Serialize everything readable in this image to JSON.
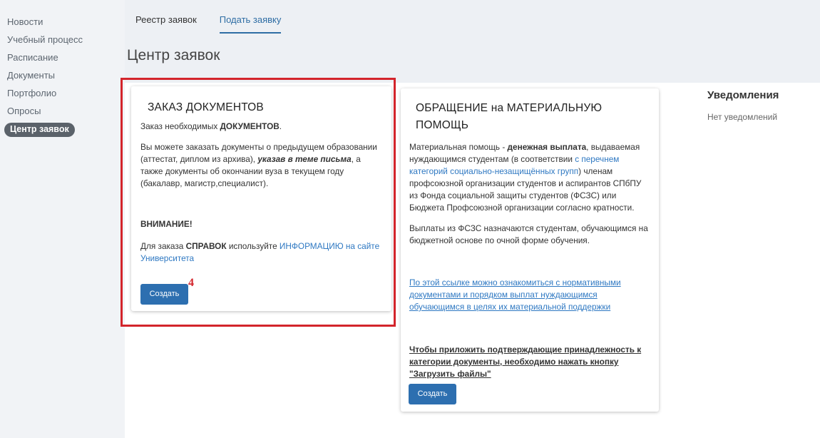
{
  "sidebar": {
    "items": [
      {
        "label": "Новости"
      },
      {
        "label": "Учебный процесс"
      },
      {
        "label": "Расписание"
      },
      {
        "label": "Документы"
      },
      {
        "label": "Портфолио"
      },
      {
        "label": "Опросы"
      },
      {
        "label": "Центр заявок",
        "active": true
      }
    ]
  },
  "tabs": [
    {
      "label": "Реестр заявок"
    },
    {
      "label": "Подать заявку",
      "active": true
    }
  ],
  "page_title": "Центр заявок",
  "card1": {
    "title": "ЗАКАЗ ДОКУМЕНТОВ",
    "intro_pre": "Заказ необходимых ",
    "intro_bold": "ДОКУМЕНТОВ",
    "intro_post": ".",
    "desc_pre": "Вы можете заказать документы о предыдущем образовании (аттестат, диплом из архива), ",
    "desc_em": "указав в теме письма",
    "desc_post": ", а также документы об окончании вуза в текущем году (бакалавр, магистр,специалист).",
    "warning": "ВНИМАНИЕ!",
    "note_pre": "Для заказа ",
    "note_bold": "СПРАВОК",
    "note_mid": " используйте ",
    "note_link": "ИНФОРМАЦИЮ на сайте Университета",
    "button": "Создать"
  },
  "card2": {
    "title_line1": "ОБРАЩЕНИЕ на МАТЕРИАЛЬНУЮ",
    "title_line2": "ПОМОЩЬ",
    "p1_pre": "Материальная помощь - ",
    "p1_bold": "денежная выплата",
    "p1_mid": ", выдаваемая нуждающимся студентам (в соответствии ",
    "p1_link": "с перечнем категорий социально-незащищённых групп",
    "p1_post": ") членам профсоюзной организации студентов и аспирантов СПбПУ из Фонда социальной защиты студентов (ФСЗС) или Бюджета Профсоюзной организации согласно кратности.",
    "p2": "Выплаты из ФСЗС назначаются студентам, обучающимся на бюджетной основе по очной форме обучения.",
    "link_text": "По этой ссылке можно ознакомиться с нормативными документами и порядком выплат нуждающимся обучающимся в целях их материальной поддержки",
    "upload_note": "Чтобы приложить подтверждающие принадлежность к категории документы, необходимо нажать кнопку \"Загрузить файлы\"",
    "button": "Создать"
  },
  "annotation": {
    "step": "4"
  },
  "notifications": {
    "title": "Уведомления",
    "empty": "Нет уведомлений"
  },
  "colors": {
    "accent": "#2e6da4",
    "button": "#2d6fb0",
    "highlight": "#d3242b",
    "sidebar_bg": "#f1f3f6",
    "header_bg": "#edf0f4"
  }
}
